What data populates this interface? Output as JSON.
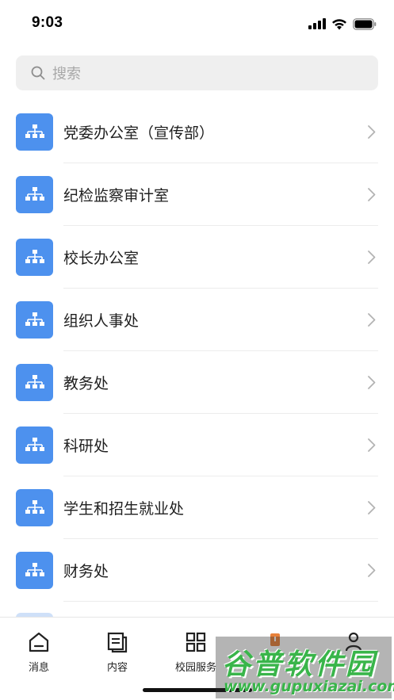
{
  "status_bar": {
    "time": "9:03"
  },
  "search": {
    "placeholder": "搜索"
  },
  "departments": [
    {
      "label": "党委办公室（宣传部）"
    },
    {
      "label": "纪检监察审计室"
    },
    {
      "label": "校长办公室"
    },
    {
      "label": "组织人事处"
    },
    {
      "label": "教务处"
    },
    {
      "label": "科研处"
    },
    {
      "label": "学生和招生就业处"
    },
    {
      "label": "财务处"
    }
  ],
  "tabs": [
    {
      "label": "消息",
      "icon": "home-icon"
    },
    {
      "label": "内容",
      "icon": "document-icon"
    },
    {
      "label": "校园服务",
      "icon": "grid-icon"
    },
    {
      "label": "",
      "icon": "notification-icon"
    },
    {
      "label": "",
      "icon": "person-icon"
    }
  ],
  "watermark": {
    "title": "谷普软件园",
    "url": "www.gupuxiazai.com"
  },
  "colors": {
    "accent": "#4d91ee",
    "watermark": "#39b54a"
  }
}
